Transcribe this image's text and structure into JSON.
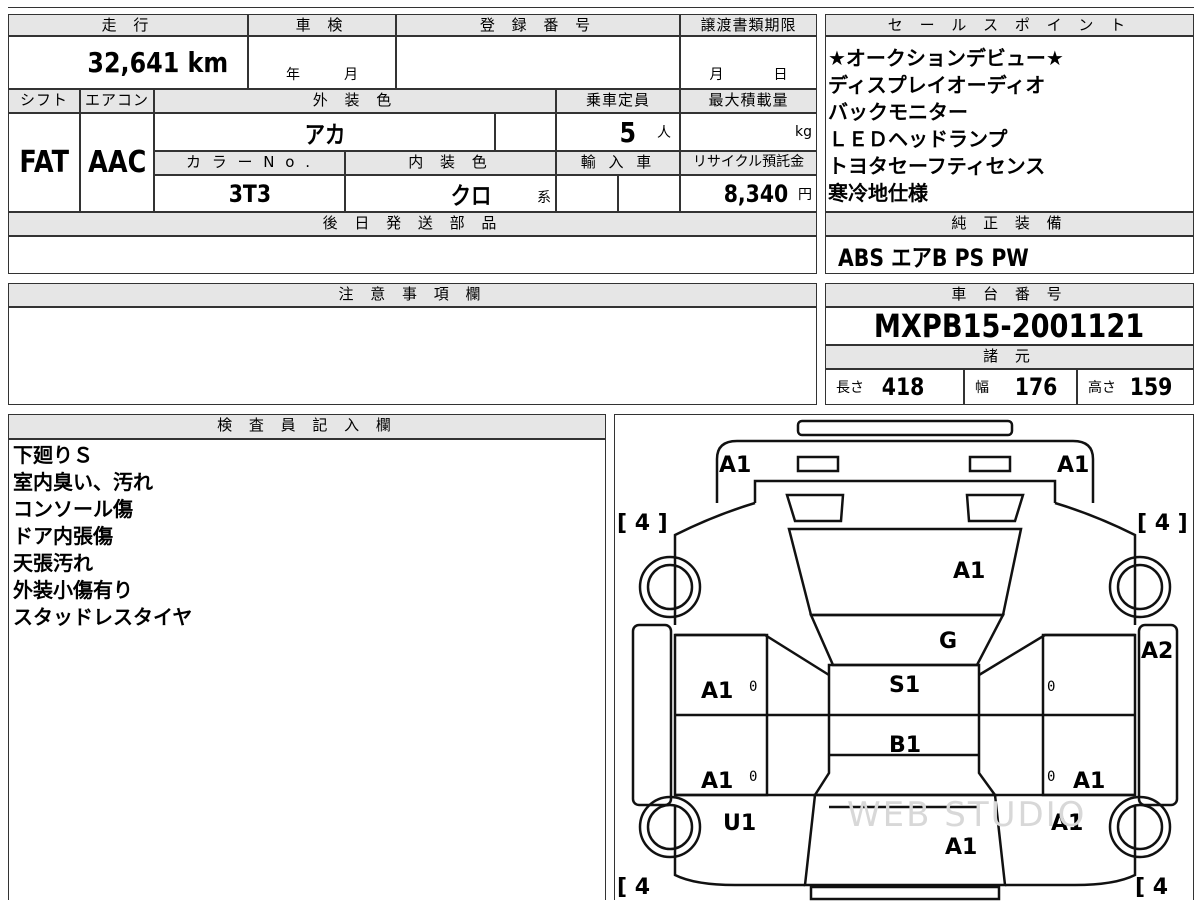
{
  "header": {
    "mileage_label": "走 行",
    "inspection_label": "車 検",
    "registration_label": "登 録 番 号",
    "transfer_label": "譲渡書類期限",
    "mileage_value": "32,641 km",
    "inspection_year_unit": "年",
    "inspection_month_unit": "月",
    "transfer_month_unit": "月",
    "transfer_day_unit": "日"
  },
  "specs": {
    "shift_label": "シフト",
    "ac_label": "エアコン",
    "exterior_color_label": "外 装 色",
    "capacity_label": "乗車定員",
    "max_load_label": "最大積載量",
    "shift_value": "FAT",
    "ac_value": "AAC",
    "exterior_color_value": "アカ",
    "capacity_value": "5",
    "capacity_unit": "人",
    "max_load_unit": "kg",
    "color_no_label": "カ ラ ー N o .",
    "interior_color_label": "内 装 色",
    "import_label": "輸 入 車",
    "recycle_label": "リサイクル預託金",
    "color_no_value": "3T3",
    "interior_color_value": "クロ",
    "interior_color_suffix": "系",
    "recycle_value": "8,340",
    "recycle_unit": "円",
    "later_parts_label": "後 日 発 送 部 品"
  },
  "sales_points": {
    "title": "セ ー ル ス ポ イ ン ト",
    "items": [
      "★オークションデビュー★",
      "ディスプレイオーディオ",
      "バックモニター",
      "ＬＥＤヘッドランプ",
      "トヨタセーフティセンス",
      "寒冷地仕様"
    ]
  },
  "equipment": {
    "title": "純 正 装 備",
    "value": "ABS エアB PS PW"
  },
  "notes": {
    "title": "注 意 事 項 欄"
  },
  "chassis": {
    "title": "車 台 番 号",
    "value": "MXPB15-2001121",
    "dims_title": "諸 元",
    "length_label": "長さ",
    "length_value": "418",
    "width_label": "幅",
    "width_value": "176",
    "height_label": "高さ",
    "height_value": "159"
  },
  "inspector": {
    "title": "検 査 員 記 入 欄",
    "lines": [
      "下廻りＳ",
      "室内臭い、汚れ",
      "コンソール傷",
      "ドア内張傷",
      "天張汚れ",
      "外装小傷有り",
      "スタッドレスタイヤ"
    ]
  },
  "diagram": {
    "marks": {
      "front_left": "A1",
      "front_right": "A1",
      "hood": "A1",
      "windshield": "G",
      "right_fender": "A2",
      "front_left_door": "A1",
      "roof_front": "S1",
      "roof_back": "B1",
      "rear_left_door": "A1",
      "rear_right_door": "A1",
      "rear_left_quarter": "U1",
      "rear_right_quarter": "A1",
      "trunk": "A1"
    },
    "tires": {
      "front_left": "[ 4 ]",
      "front_right": "[ 4 ]",
      "rear_left": "[ 4",
      "rear_right": "[ 4"
    },
    "door_zero": "0",
    "watermark": "WEB STUDIO"
  }
}
